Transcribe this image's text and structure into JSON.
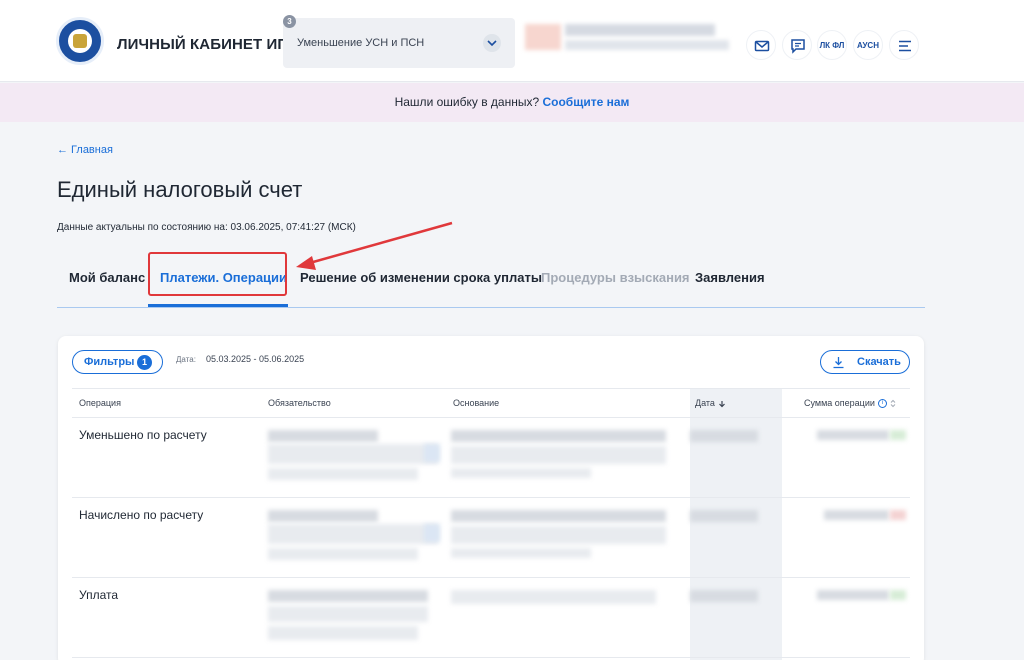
{
  "header": {
    "brand": "ЛИЧНЫЙ КАБИНЕТ ИП",
    "selector": {
      "badge": "3",
      "value": "Уменьшение УСН и ПСН"
    },
    "icons": [
      {
        "name": "mail-icon"
      },
      {
        "name": "chat-icon"
      },
      {
        "name": "lk-fl-link",
        "label": "ЛК ФЛ"
      },
      {
        "name": "ausn-link",
        "label": "АУСН"
      },
      {
        "name": "menu-icon"
      }
    ]
  },
  "notice": {
    "text": "Нашли ошибку в данных? ",
    "link": "Сообщите нам"
  },
  "breadcrumb": "← Главная",
  "page_title": "Единый налоговый счет",
  "timestamp": "Данные актуальны по состоянию на: 03.06.2025, 07:41:27 (МСК)",
  "tabs": [
    {
      "label": "Мой баланс",
      "state": "default"
    },
    {
      "label": "Платежи. Операции",
      "state": "active"
    },
    {
      "label": "Решение об изменении срока уплаты",
      "state": "default"
    },
    {
      "label": "Процедуры взыскания",
      "state": "disabled"
    },
    {
      "label": "Заявления",
      "state": "default"
    }
  ],
  "filters": {
    "label": "Фильтры",
    "count": "1"
  },
  "date_filter": {
    "label": "Дата:",
    "value": "05.03.2025 - 05.06.2025"
  },
  "download": {
    "label": "Скачать"
  },
  "table": {
    "columns": [
      "Операция",
      "Обязательство",
      "Основание",
      "Дата",
      "Сумма операции"
    ],
    "rows": [
      {
        "operation": "Уменьшено по расчету",
        "amount_color": "green"
      },
      {
        "operation": "Начислено по расчету",
        "amount_color": "red"
      },
      {
        "operation": "Уплата",
        "amount_color": "green"
      }
    ]
  },
  "colors": {
    "accent": "#1a6ed8",
    "highlight": "#e0383b",
    "notice_bg": "#f3e9f4"
  }
}
